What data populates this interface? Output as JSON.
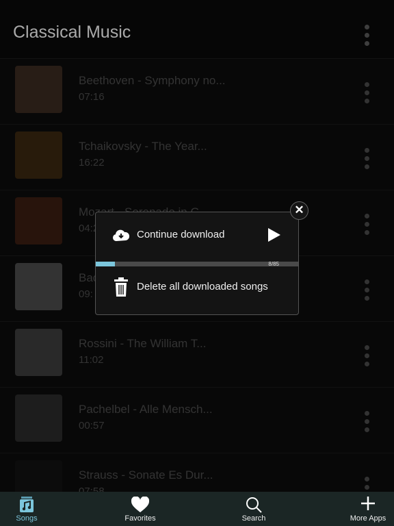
{
  "header": {
    "title": "Classical Music"
  },
  "songs": [
    {
      "title": "Beethoven - Symphony no...",
      "duration": "07:16",
      "thumb": "#3a2a20"
    },
    {
      "title": "Tchaikovsky - The Year...",
      "duration": "16:22",
      "thumb": "#3a2810"
    },
    {
      "title": "Mozart - Serenade in G...",
      "duration": "04:2",
      "thumb": "#3a1e12"
    },
    {
      "title": "Bac",
      "duration": "09:",
      "thumb": "#4a4a4a"
    },
    {
      "title": "Rossini - The William T...",
      "duration": "11:02",
      "thumb": "#3c3c3c"
    },
    {
      "title": "Pachelbel - Alle Mensch...",
      "duration": "00:57",
      "thumb": "#2a2a2a"
    },
    {
      "title": "Strauss - Sonate Es Dur...",
      "duration": "07:58",
      "thumb": "#121212"
    }
  ],
  "popup": {
    "continue_label": "Continue download",
    "delete_label": "Delete all downloaded songs",
    "progress_text": "8/85",
    "progress": 0.094
  },
  "tabs": [
    {
      "label": "Songs",
      "active": true
    },
    {
      "label": "Favorites"
    },
    {
      "label": "Search"
    },
    {
      "label": "More Apps"
    }
  ],
  "colors": {
    "accent": "#7cc6dc",
    "tabbar": "#1b2625"
  }
}
